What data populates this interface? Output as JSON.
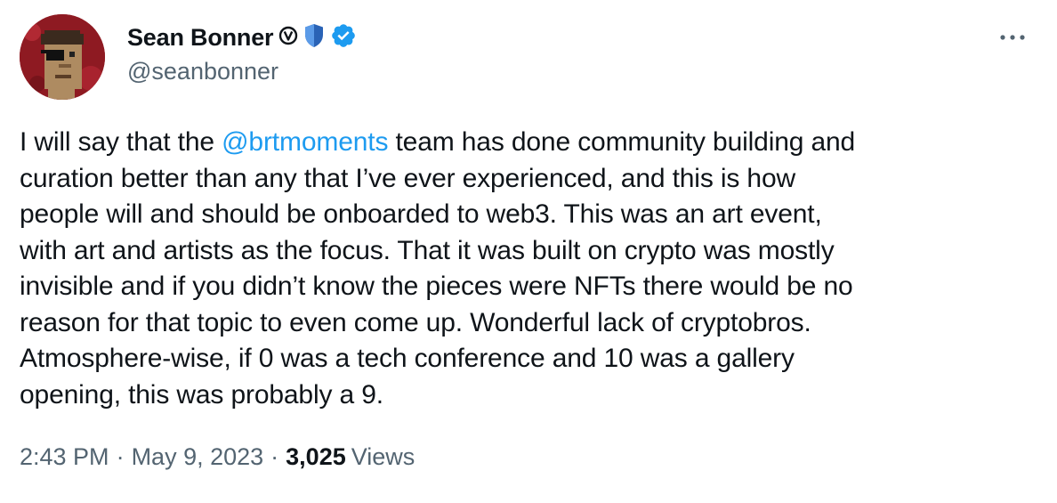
{
  "author": {
    "display_name": "Sean Bonner",
    "handle": "@seanbonner",
    "badges": [
      "circled-v-icon",
      "blue-shield-icon",
      "verified-check-icon"
    ]
  },
  "tweet": {
    "text_before_mention": "I will say that the ",
    "mention": "@brtmoments",
    "text_after_mention": " team has done community building and\ncuration better than any that I’ve ever experienced, and this is how\npeople will and should be onboarded to web3. This was an art event,\nwith art and artists as the focus. That it was built on crypto was mostly\ninvisible and if you didn’t know the pieces were NFTs there would be no\nreason for that topic to even come up. Wonderful lack of cryptobros.\nAtmosphere-wise, if 0 was a tech conference and 10 was a gallery\nopening, this was probably a 9."
  },
  "meta": {
    "time": "2:43 PM",
    "separator": "·",
    "date": "May 9, 2023",
    "views_count": "3,025",
    "views_label": "Views"
  },
  "colors": {
    "link": "#1d9bf0",
    "secondary": "#536471",
    "verified": "#1d9bf0"
  }
}
